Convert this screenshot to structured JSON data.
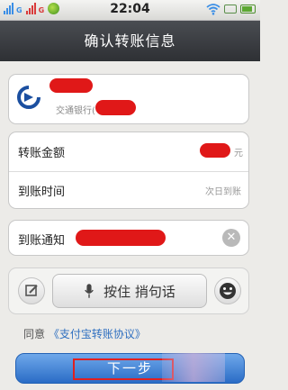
{
  "status_bar": {
    "time": "22:04",
    "network_1": "G",
    "network_2": "G"
  },
  "header": {
    "title": "确认转账信息"
  },
  "recipient": {
    "bank_name": "交通银行("
  },
  "transfer": {
    "amount_label": "转账金额",
    "amount_unit": "元",
    "arrival_label": "到账时间",
    "arrival_value": "次日到账"
  },
  "notice": {
    "label": "到账通知"
  },
  "voice": {
    "talk_label": "按住 捎句话"
  },
  "agreement": {
    "prefix": "同意",
    "link": "《支付宝转账协议》"
  },
  "actions": {
    "next_label": "下一步"
  },
  "colors": {
    "header_bg": "#3a3c40",
    "button_blue": "#3b7fd6",
    "link_blue": "#2f6fc0",
    "redaction_red": "#e01818"
  }
}
